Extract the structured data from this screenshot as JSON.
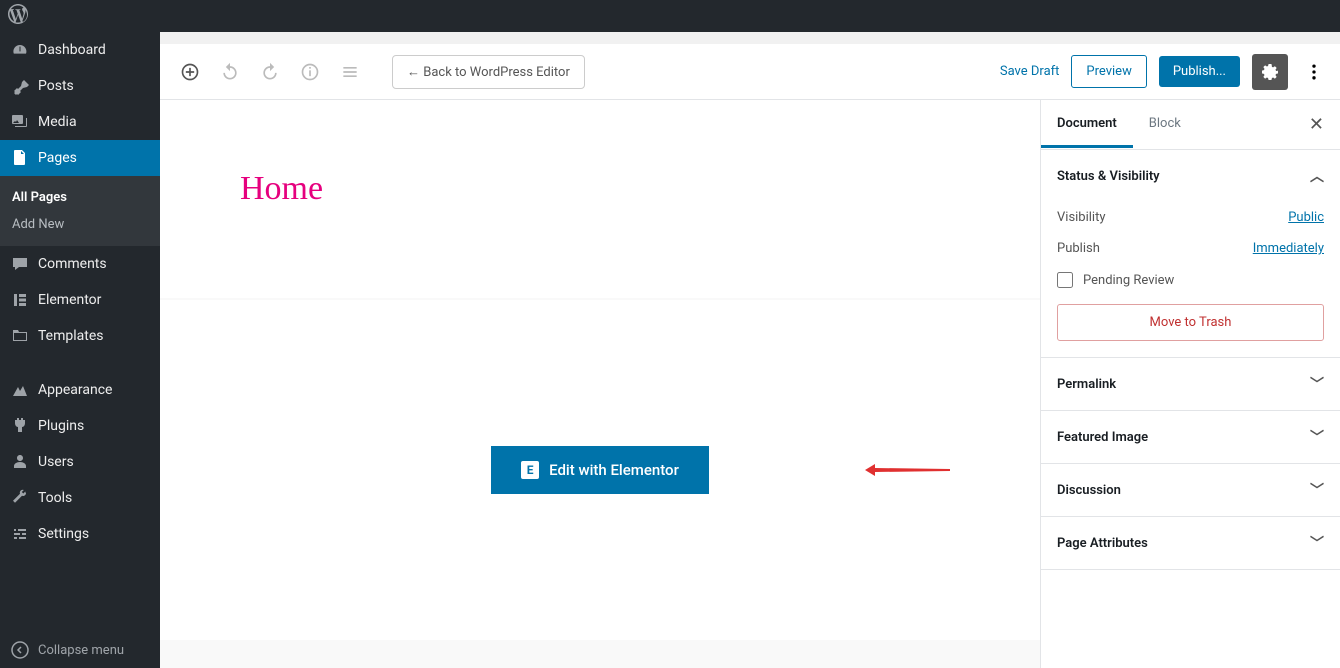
{
  "sidebar": {
    "items": [
      {
        "label": "Dashboard",
        "icon": "dashboard"
      },
      {
        "label": "Posts",
        "icon": "pin"
      },
      {
        "label": "Media",
        "icon": "media"
      },
      {
        "label": "Pages",
        "icon": "pages",
        "active": true
      },
      {
        "label": "Comments",
        "icon": "comments"
      },
      {
        "label": "Elementor",
        "icon": "elementor"
      },
      {
        "label": "Templates",
        "icon": "templates"
      },
      {
        "label": "Appearance",
        "icon": "appearance"
      },
      {
        "label": "Plugins",
        "icon": "plugins"
      },
      {
        "label": "Users",
        "icon": "users"
      },
      {
        "label": "Tools",
        "icon": "tools"
      },
      {
        "label": "Settings",
        "icon": "settings"
      }
    ],
    "sub": {
      "all": "All Pages",
      "add": "Add New"
    },
    "collapse": "Collapse menu"
  },
  "toolbar": {
    "back": "←  Back to WordPress Editor",
    "save_draft": "Save Draft",
    "preview": "Preview",
    "publish": "Publish..."
  },
  "editor": {
    "title": "Home",
    "elementor_btn": "Edit with Elementor"
  },
  "inspector": {
    "tabs": {
      "document": "Document",
      "block": "Block"
    },
    "close": "✕",
    "status": {
      "title": "Status & Visibility",
      "visibility_label": "Visibility",
      "visibility_value": "Public",
      "publish_label": "Publish",
      "publish_value": "Immediately",
      "pending": "Pending Review",
      "trash": "Move to Trash"
    },
    "panels": {
      "permalink": "Permalink",
      "featured": "Featured Image",
      "discussion": "Discussion",
      "attributes": "Page Attributes"
    }
  }
}
